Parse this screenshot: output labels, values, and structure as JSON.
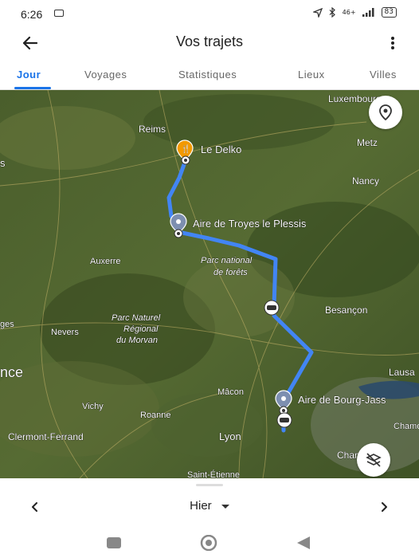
{
  "status_bar": {
    "time": "6:26",
    "signal": "46+",
    "battery": "83"
  },
  "app_bar": {
    "title": "Vos trajets"
  },
  "tabs": [
    {
      "label": "Jour",
      "active": true
    },
    {
      "label": "Voyages"
    },
    {
      "label": "Statistiques"
    },
    {
      "label": "Lieux"
    },
    {
      "label": "Villes"
    }
  ],
  "map": {
    "labels": {
      "luxembourg": "Luxembourg",
      "reims": "Reims",
      "metz": "Metz",
      "nancy": "Nancy",
      "auxerre": "Auxerre",
      "besancon": "Besançon",
      "nevers": "Nevers",
      "park_morvan_1": "Parc Naturel",
      "park_morvan_2": "Régional",
      "park_morvan_3": "du Morvan",
      "park_forets_1": "Parc national",
      "park_forets_2": "de forêts",
      "macon": "Mâcon",
      "lausanne": "Lausa",
      "vichy": "Vichy",
      "roanne": "Roanne",
      "clermont": "Clermont-Ferrand",
      "lyon": "Lyon",
      "chambery": "Chamb",
      "chamonix": "Chamo",
      "saint_etienne": "Saint-Étienne",
      "france": "nce",
      "paris_edge": "s",
      "ges_edge": "ges"
    },
    "places": {
      "delko": "Le Delko",
      "troyes": "Aire de Troyes le Plessis",
      "bourg": "Aire de Bourg-Jass"
    },
    "route_color": "#4285f4"
  },
  "bottom_sheet": {
    "day_label": "Hier"
  }
}
